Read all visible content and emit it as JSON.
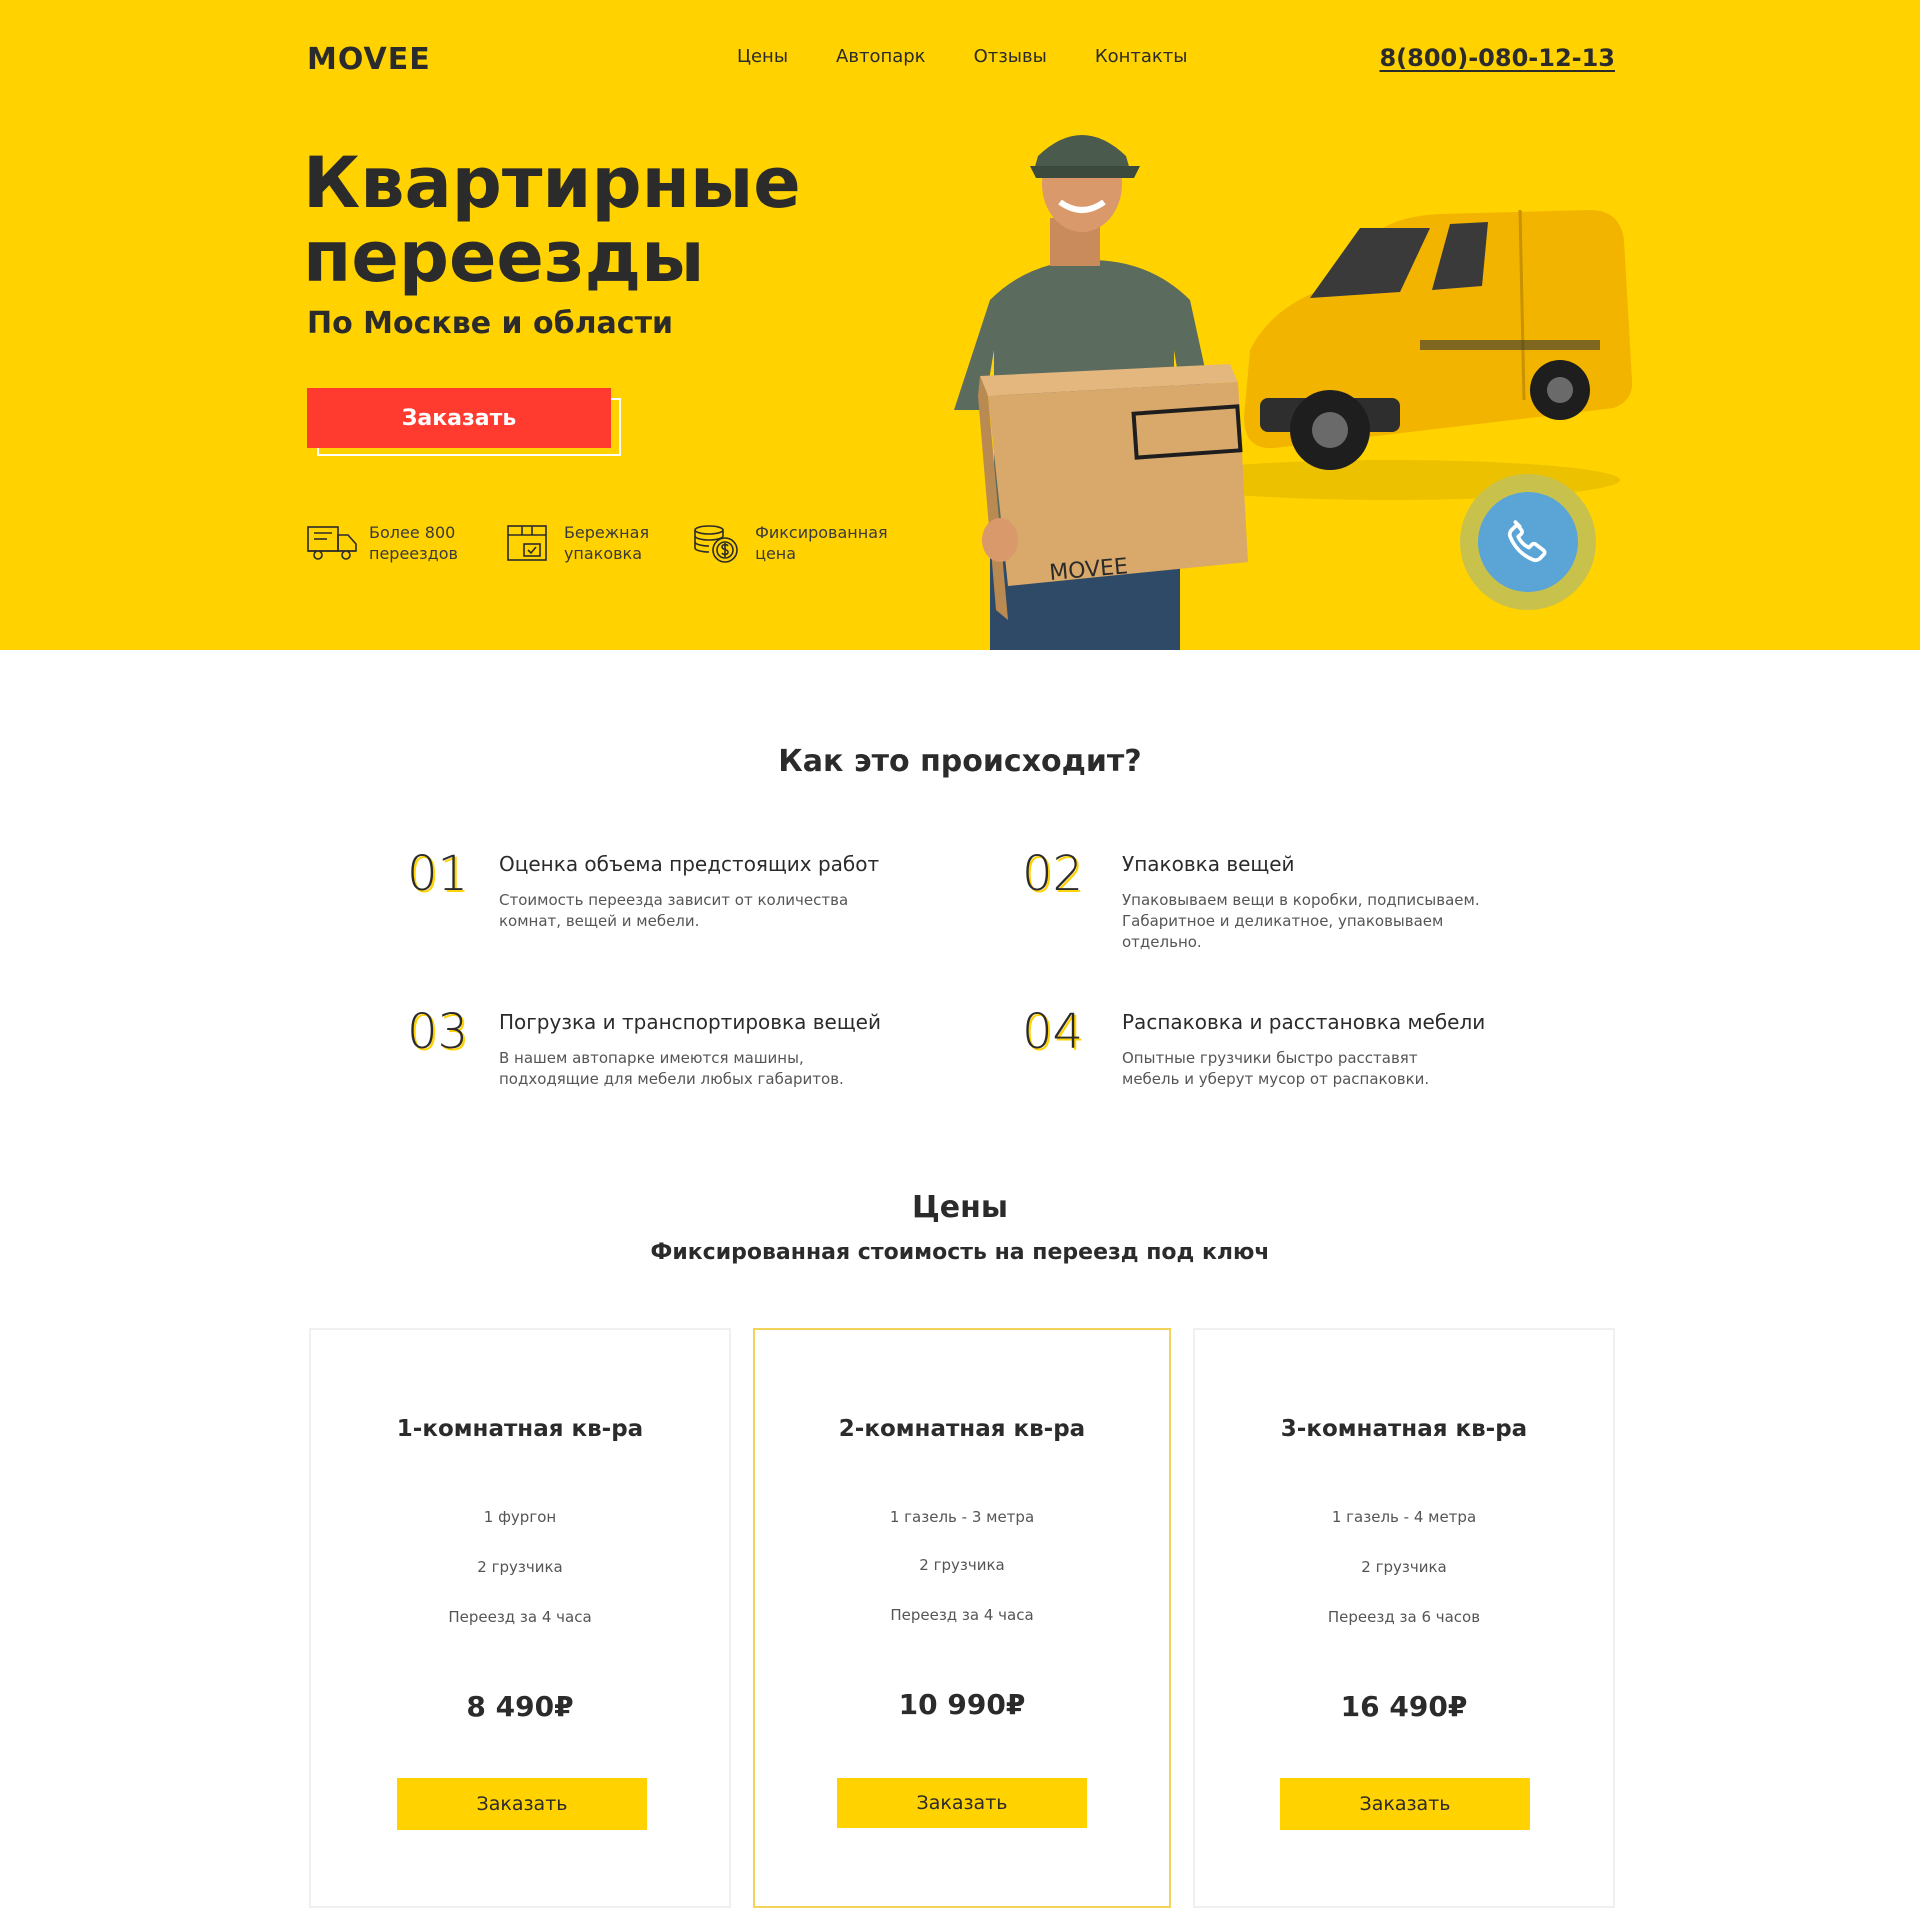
{
  "header": {
    "logo": "MOVEE",
    "nav": [
      "Цены",
      "Автопарк",
      "Отзывы",
      "Контакты"
    ],
    "phone": "8(800)-080-12-13"
  },
  "hero": {
    "title_line1": "Квартирные",
    "title_line2": "переезды",
    "subtitle": "По Москве и области",
    "order_label": "Заказать",
    "box_label": "MOVEE",
    "features": [
      {
        "icon": "truck-icon",
        "text": "Более 800\nпереездов"
      },
      {
        "icon": "package-icon",
        "text": "Бережная\nупаковка"
      },
      {
        "icon": "coins-icon",
        "text": "Фиксированная\nцена"
      }
    ]
  },
  "how": {
    "title": "Как это происходит?",
    "steps": [
      {
        "num": "01",
        "title": "Оценка объема предстоящих работ",
        "desc": "Стоимость переезда зависит от количества\nкомнат, вещей и мебели."
      },
      {
        "num": "02",
        "title": "Упаковка вещей",
        "desc": "Упаковываем вещи в коробки, подписываем.\nГабаритное и деликатное,  упаковываем\nотдельно."
      },
      {
        "num": "03",
        "title": "Погрузка и транспортировка вещей",
        "desc": "В нашем автопарке имеются машины,\nподходящие для мебели любых габаритов."
      },
      {
        "num": "04",
        "title": "Распаковка и расстановка мебели",
        "desc": "Опытные грузчики быстро расставят\nмебель и уберут мусор от распаковки."
      }
    ]
  },
  "prices": {
    "title": "Цены",
    "subtitle": "Фиксированная стоимость на переезд под ключ",
    "cards": [
      {
        "title": "1-комнатная кв-ра",
        "lines": [
          "1 фургон",
          "2 грузчика",
          "Переезд за 4 часа"
        ],
        "price": "8 490₽",
        "button": "Заказать"
      },
      {
        "title": "2-комнатная кв-ра",
        "lines": [
          "1 газель - 3 метра",
          "2 грузчика",
          "Переезд за 4 часа"
        ],
        "price": "10 990₽",
        "button": "Заказать"
      },
      {
        "title": "3-комнатная кв-ра",
        "lines": [
          "1 газель - 4 метра",
          "2 грузчика",
          "Переезд за 6 часов"
        ],
        "price": "16 490₽",
        "button": "Заказать"
      }
    ]
  },
  "colors": {
    "accent": "#ffd200",
    "cta": "#ff3a2f",
    "text": "#2b2b2b",
    "call": "#5aa4d6"
  }
}
